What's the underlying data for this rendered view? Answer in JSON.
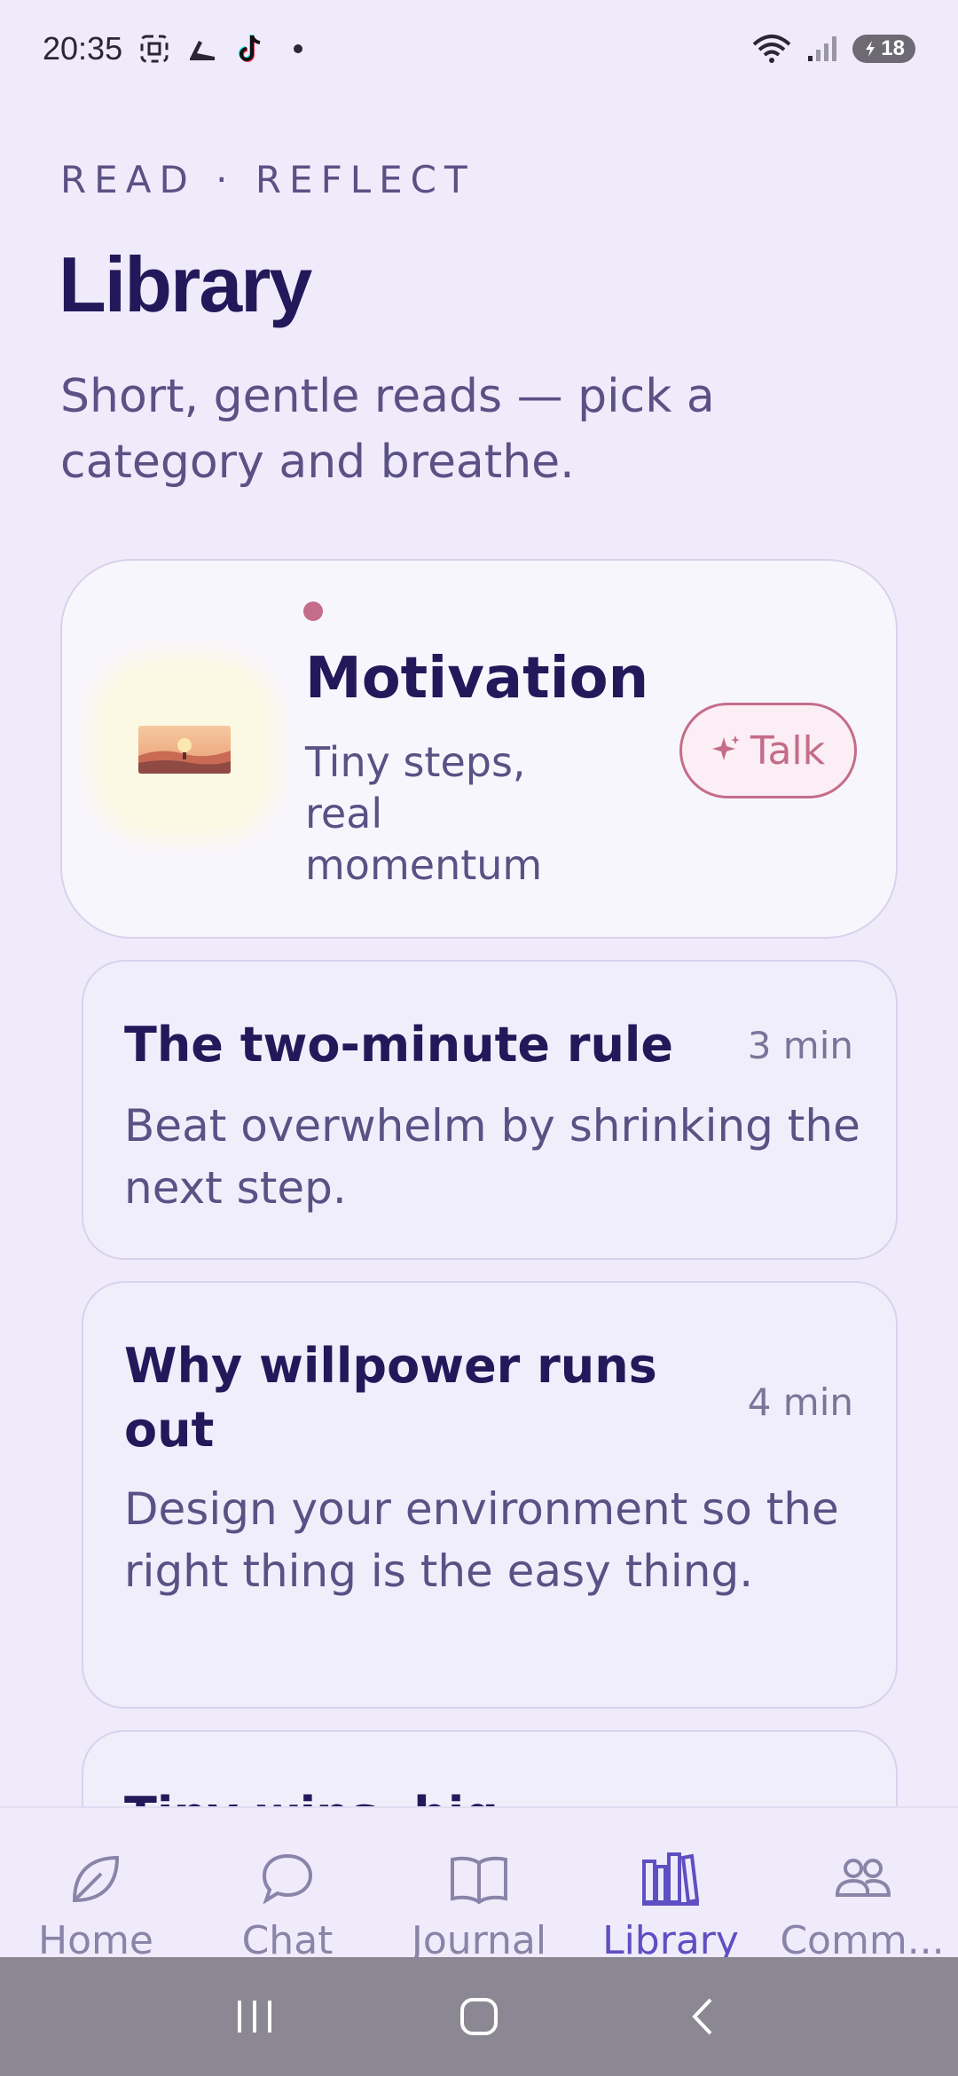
{
  "status_bar": {
    "time": "20:35",
    "battery": "18",
    "icons": [
      "screenshot-icon",
      "running-shoe-icon",
      "tiktok-icon",
      "dot-icon",
      "wifi-icon",
      "signal-icon",
      "battery-icon"
    ]
  },
  "header": {
    "eyebrow": "READ · REFLECT",
    "title": "Library",
    "subtitle": "Short, gentle reads — pick a category and breathe."
  },
  "category": {
    "title": "Motivation",
    "description": "Tiny steps, real momentum",
    "talk_label": "Talk",
    "accent": "#c46d8a"
  },
  "articles": [
    {
      "title": "The two-minute rule",
      "time": "3 min",
      "description": "Beat overwhelm by shrinking the next step."
    },
    {
      "title": "Why willpower runs out",
      "time": "4 min",
      "description": "Design your environment so the right thing is the easy thing."
    },
    {
      "title": "Tiny wins, big",
      "time": "",
      "description": ""
    }
  ],
  "nav": {
    "items": [
      {
        "label": "Home",
        "icon": "leaf-icon"
      },
      {
        "label": "Chat",
        "icon": "chat-bubble-icon"
      },
      {
        "label": "Journal",
        "icon": "open-book-icon"
      },
      {
        "label": "Library",
        "icon": "library-books-icon"
      },
      {
        "label": "Comm...",
        "icon": "community-people-icon"
      }
    ],
    "active": "Library",
    "active_color": "#5e4fc2",
    "inactive_color": "#8a84a8"
  },
  "system_nav": {
    "buttons": [
      "recents-icon",
      "home-circle-icon",
      "back-chevron-icon"
    ]
  }
}
